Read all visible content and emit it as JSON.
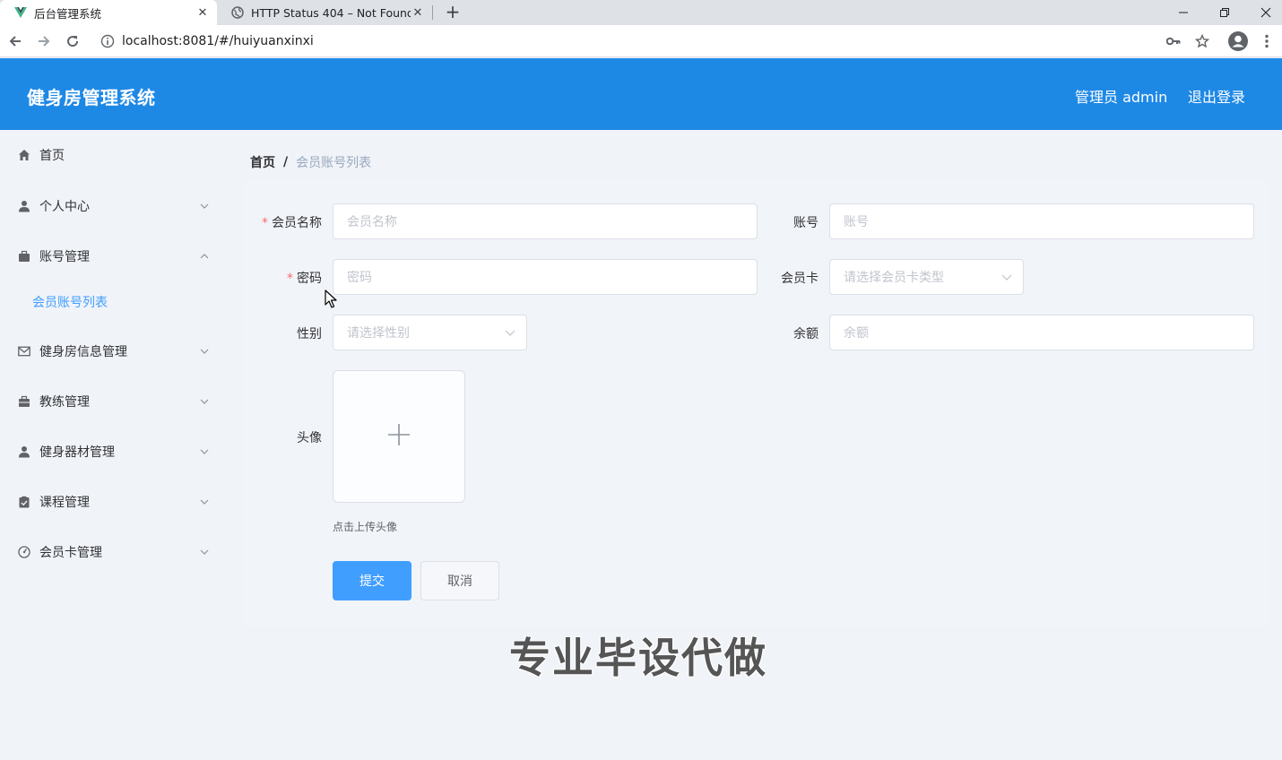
{
  "browser": {
    "tabs": [
      {
        "title": "后台管理系统",
        "active": true
      },
      {
        "title": "HTTP Status 404 – Not Found",
        "active": false
      }
    ],
    "url": "localhost:8081/#/huiyuanxinxi"
  },
  "header": {
    "brand": "健身房管理系统",
    "admin": "管理员 admin",
    "logout": "退出登录",
    "color": "#1e88e5"
  },
  "sidebar": {
    "items": [
      {
        "label": "首页",
        "icon": "home-icon"
      },
      {
        "label": "个人中心",
        "icon": "user-icon",
        "expanded": false
      },
      {
        "label": "账号管理",
        "icon": "briefcase-icon",
        "expanded": true
      },
      {
        "label": "健身房信息管理",
        "icon": "mail-icon",
        "expanded": false
      },
      {
        "label": "教练管理",
        "icon": "suitcase-icon",
        "expanded": false
      },
      {
        "label": "健身器材管理",
        "icon": "user-icon",
        "expanded": false
      },
      {
        "label": "课程管理",
        "icon": "clipboard-icon",
        "expanded": false
      },
      {
        "label": "会员卡管理",
        "icon": "gauge-icon",
        "expanded": false
      }
    ],
    "sub_items": [
      {
        "label": "会员账号列表",
        "active": true
      }
    ]
  },
  "breadcrumb": {
    "home": "首页",
    "separator": "/",
    "current": "会员账号列表"
  },
  "form": {
    "member_name": {
      "label": "会员名称",
      "placeholder": "会员名称",
      "required": true
    },
    "account": {
      "label": "账号",
      "placeholder": "账号"
    },
    "password": {
      "label": "密码",
      "placeholder": "密码",
      "required": true
    },
    "card": {
      "label": "会员卡",
      "placeholder": "请选择会员卡类型"
    },
    "gender": {
      "label": "性别",
      "placeholder": "请选择性别"
    },
    "balance": {
      "label": "余额",
      "placeholder": "余额"
    },
    "avatar": {
      "label": "头像",
      "tip": "点击上传头像"
    },
    "required_mark": "*",
    "submit": "提交",
    "cancel": "取消"
  },
  "watermark": "专业毕设代做"
}
